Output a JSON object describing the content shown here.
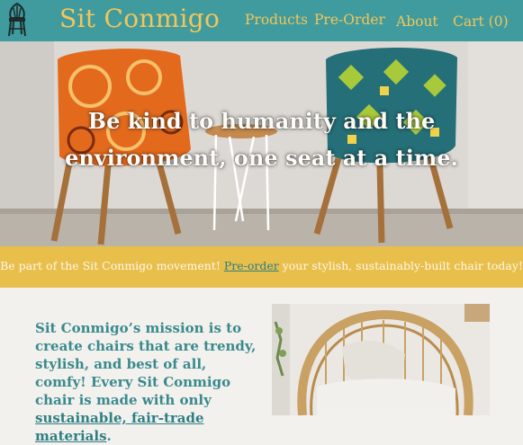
{
  "header": {
    "brand": "Sit Conmigo",
    "nav": [
      {
        "label": "Products"
      },
      {
        "label": "Pre-Order"
      },
      {
        "label": "About"
      },
      {
        "label": "Cart (0)"
      }
    ]
  },
  "hero": {
    "line1": "Be kind to humanity and the",
    "line2": "environment, one seat at a time."
  },
  "banner": {
    "before": "Be part of the Sit Conmigo movement! ",
    "link": "Pre-order",
    "after": " your stylish, sustainably-built chair today!"
  },
  "mission": {
    "text": "Sit Conmigo’s mission is to create chairs that are trendy, stylish, and best of all, comfy! Every Sit Conmigo chair is made with only ",
    "link": "sustainable, fair-trade materials",
    "after": "."
  },
  "colors": {
    "header_bg": "#3f9b9e",
    "accent_yellow": "#f4c55a",
    "banner_bg": "#e9bf4c",
    "mission_text": "#3a8a8d"
  }
}
